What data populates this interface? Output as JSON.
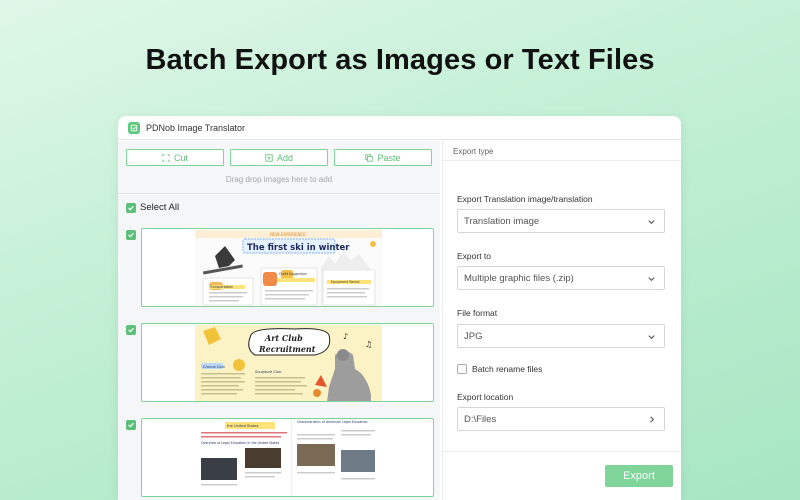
{
  "headline": "Batch Export as Images or Text Files",
  "window": {
    "title": "PDNob Image Translator"
  },
  "toolbar": {
    "cut_label": "Cut",
    "add_label": "Add",
    "paste_label": "Paste"
  },
  "drag_hint": "Drag drop images here to add",
  "select_all_label": "Select All",
  "images": [
    {
      "checked": true,
      "title": "The first ski in winter",
      "banner": "NEW EXPERIENCE",
      "labels": [
        "Outfit Suggestion",
        "Transportation",
        "Equipment Rental"
      ]
    },
    {
      "checked": true,
      "title_line1": "Art Club",
      "title_line2": "Recruitment",
      "labels": [
        "Chorus Club",
        "Sculpture Club"
      ]
    },
    {
      "checked": true,
      "header_left": "the United States",
      "header_right": "Characteristics of American Legal Education",
      "labels": [
        "Overview of Legal Education in the United States"
      ]
    }
  ],
  "right_panel": {
    "header": "Export type",
    "export_translation_label": "Export Translation image/translation",
    "export_translation_value": "Translation image",
    "export_to_label": "Export to",
    "export_to_value": "Multiple graphic files (.zip)",
    "file_format_label": "File format",
    "file_format_value": "JPG",
    "batch_rename_label": "Batch rename files",
    "batch_rename_checked": false,
    "export_location_label": "Export location",
    "export_location_value": "D:\\Files",
    "export_button": "Export"
  },
  "colors": {
    "accent": "#5cbf7a",
    "accent_light": "#7fd49a"
  }
}
